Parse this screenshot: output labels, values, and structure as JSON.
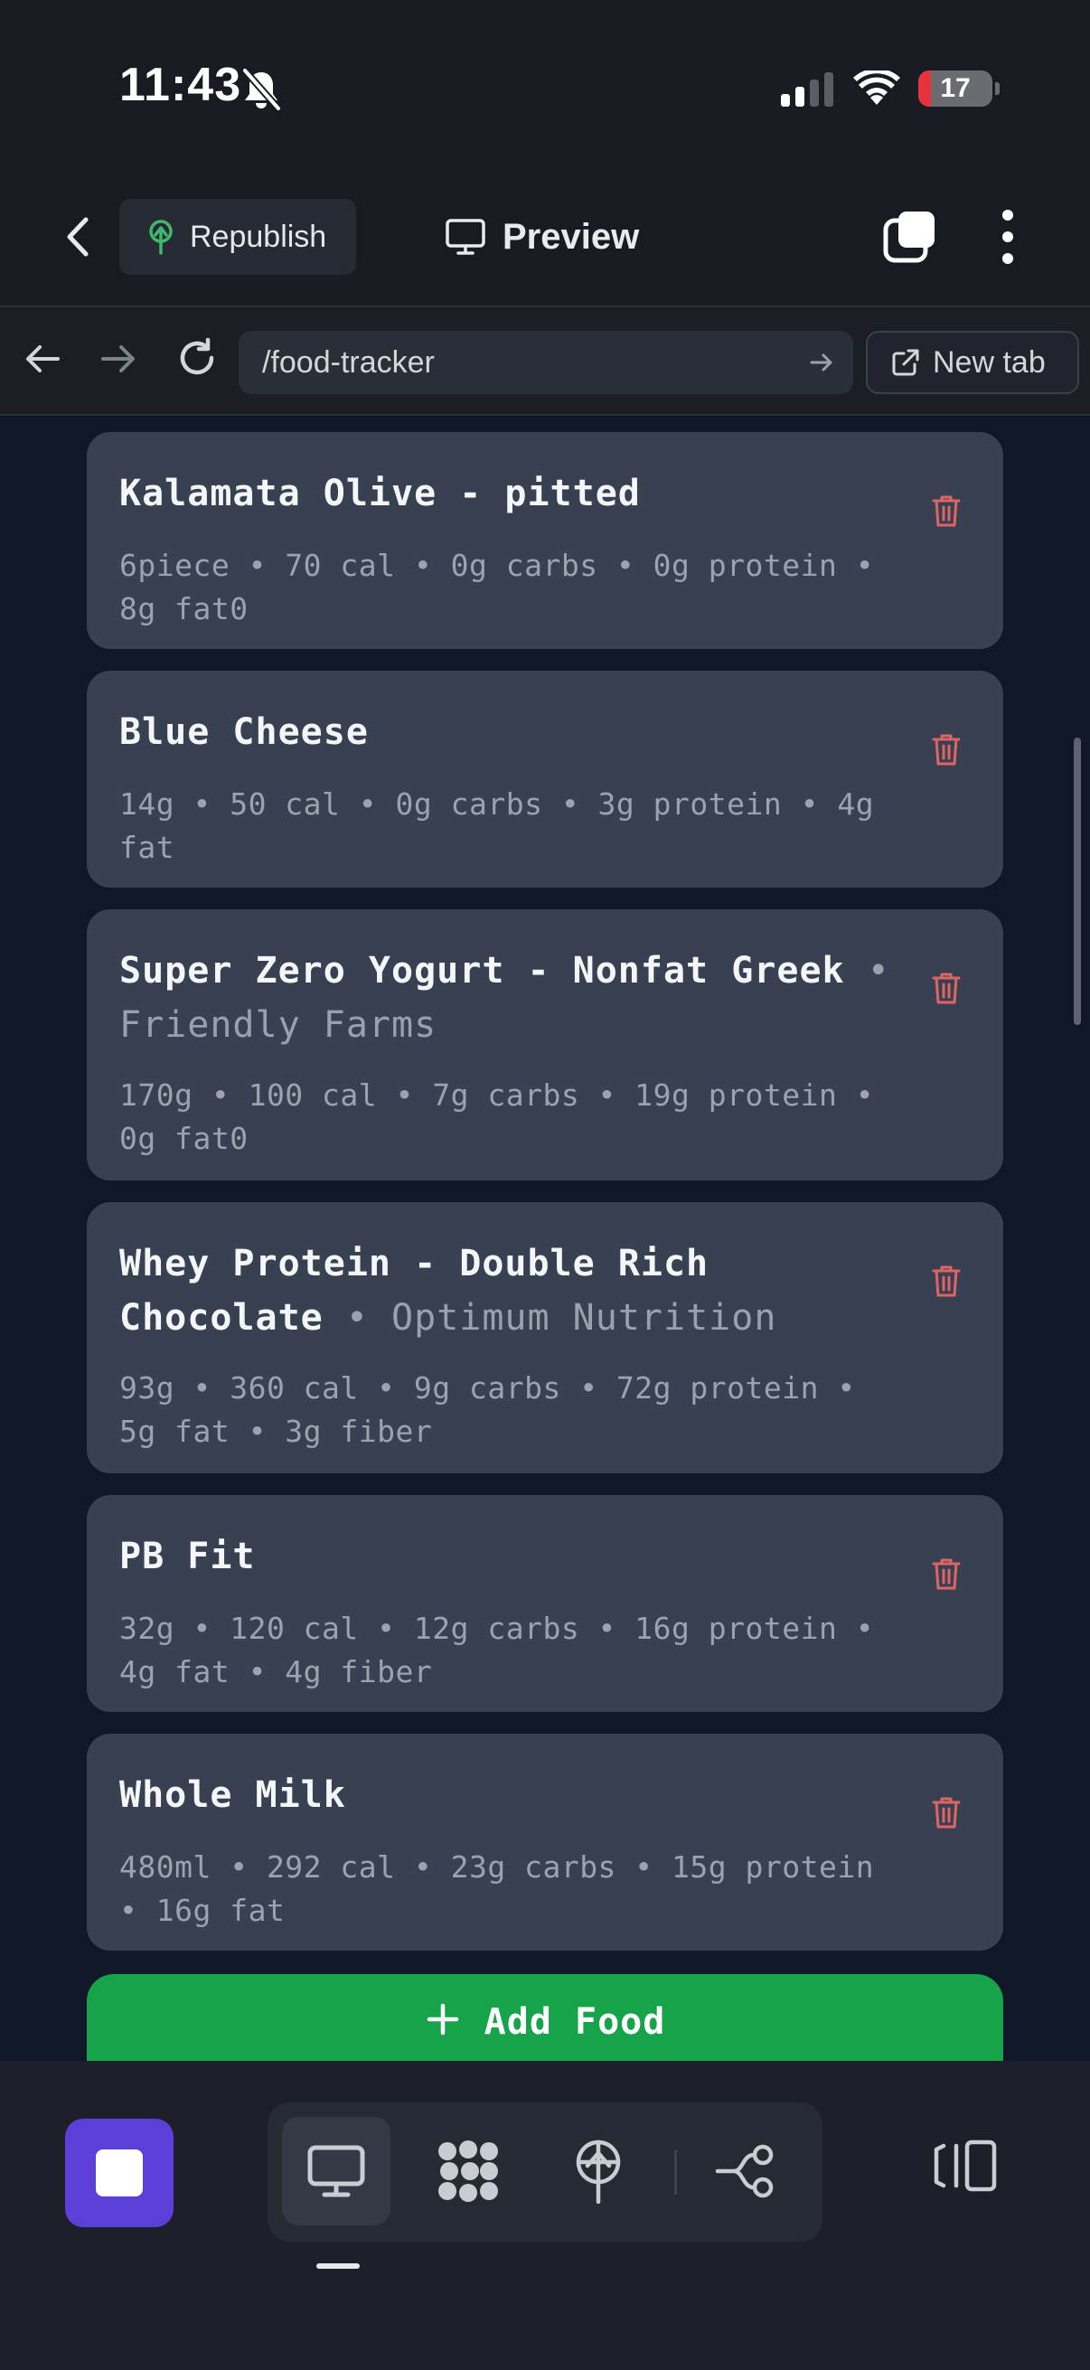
{
  "status_bar": {
    "time": "11:43",
    "battery_level": "17",
    "battery_fraction": 0.17,
    "icons": [
      "bell-slash-icon",
      "signal-icon",
      "wifi-icon",
      "battery-icon"
    ]
  },
  "header": {
    "back_icon": "chevron-left-icon",
    "republish_label": "Republish",
    "preview_label": "Preview",
    "icons": [
      "pages-icon",
      "more-vertical-icon"
    ]
  },
  "browser": {
    "url": "/food-tracker",
    "new_tab_label": "New tab"
  },
  "foods": [
    {
      "name": "Kalamata Olive - pitted",
      "brand": "",
      "meta": "6piece • 70 cal • 0g carbs • 0g protein • 8g fat0"
    },
    {
      "name": "Blue Cheese",
      "brand": "",
      "meta": "14g • 50 cal • 0g carbs • 3g protein • 4g fat"
    },
    {
      "name": "Super Zero Yogurt - Nonfat Greek",
      "brand": "Friendly Farms",
      "meta": "170g • 100 cal • 7g carbs • 19g protein • 0g fat0"
    },
    {
      "name": "Whey Protein - Double Rich Chocolate",
      "brand": "Optimum Nutrition",
      "meta": "93g • 360 cal • 9g carbs • 72g protein • 5g fat • 3g fiber"
    },
    {
      "name": "PB Fit",
      "brand": "",
      "meta": "32g • 120 cal • 12g carbs • 16g protein • 4g fat • 4g fiber"
    },
    {
      "name": "Whole Milk",
      "brand": "",
      "meta": "480ml • 292 cal • 23g carbs • 15g protein • 16g fat"
    }
  ],
  "add_food_label": "Add Food",
  "colors": {
    "accent_green": "#16a34a",
    "delete_red": "#e06464",
    "stop_purple": "#5b3fd6",
    "card_bg": "#374151"
  }
}
